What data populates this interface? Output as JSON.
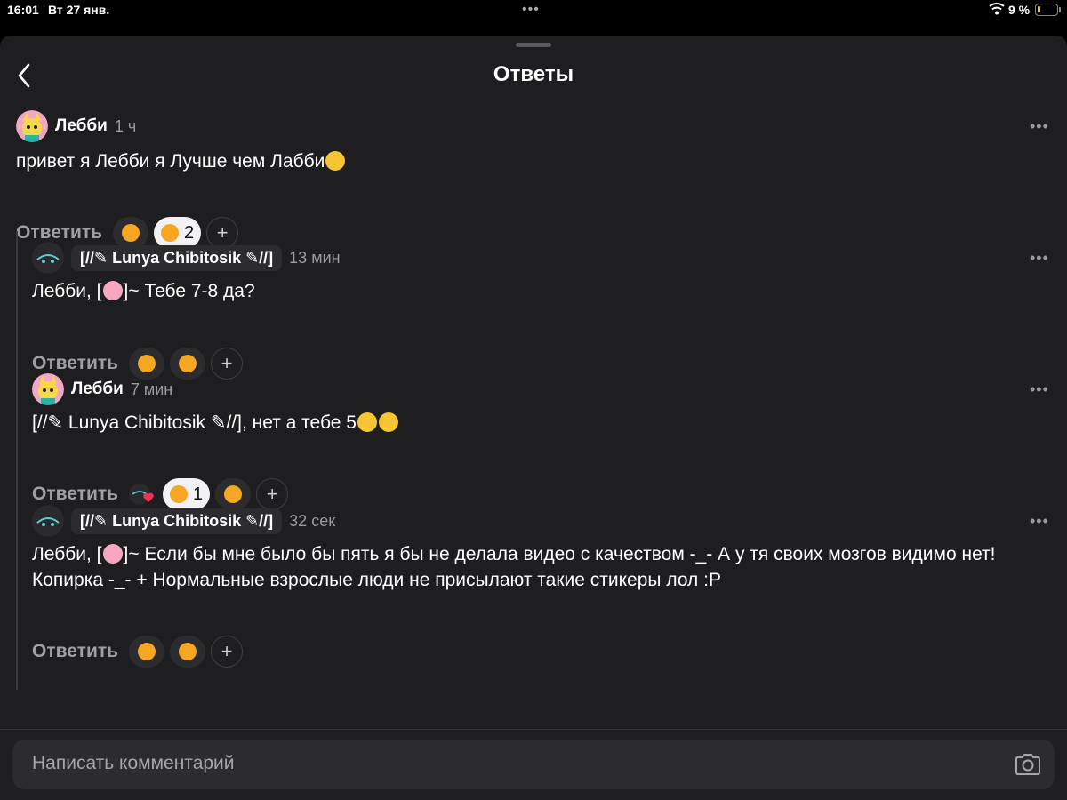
{
  "status_bar": {
    "time": "16:01",
    "date": "Вт 27 янв.",
    "battery": "9 %"
  },
  "header": {
    "title": "Ответы"
  },
  "comments": [
    {
      "author": "Лебби",
      "time": "1 ч",
      "text": "привет я Лебби я Лучше чем Лабби",
      "reply_label": "Ответить",
      "dislike_count": "2"
    },
    {
      "author": "[//✎ Lunya Chibitosik ✎//]",
      "time": "13 мин",
      "text_prefix": "Лебби, [",
      "text_suffix": "]~ Тебе 7-8 да?",
      "reply_label": "Ответить"
    },
    {
      "author": "Лебби",
      "time": "7 мин",
      "text": "[//✎ Lunya Chibitosik ✎//], нет а тебе 5",
      "reply_label": "Ответить",
      "like_count": "1"
    },
    {
      "author": "[//✎ Lunya Chibitosik ✎//]",
      "time": "32 сек",
      "text_prefix": "Лебби, [",
      "text_line1_suffix": "]~ Если бы мне было бы пять я бы не делала видео с качеством -_- А у тя своих мозгов видимо нет!",
      "text_line2": "Копирка -_- + Нормальные взрослые люди не присылают такие стикеры лол :P",
      "reply_label": "Ответить"
    }
  ],
  "composer": {
    "placeholder": "Написать комментарий"
  },
  "icons": [
    "back-chevron-icon",
    "more-icon",
    "thumbs-up-icon",
    "thumbs-down-icon",
    "plus-icon",
    "camera-icon",
    "wifi-icon",
    "battery-icon"
  ]
}
